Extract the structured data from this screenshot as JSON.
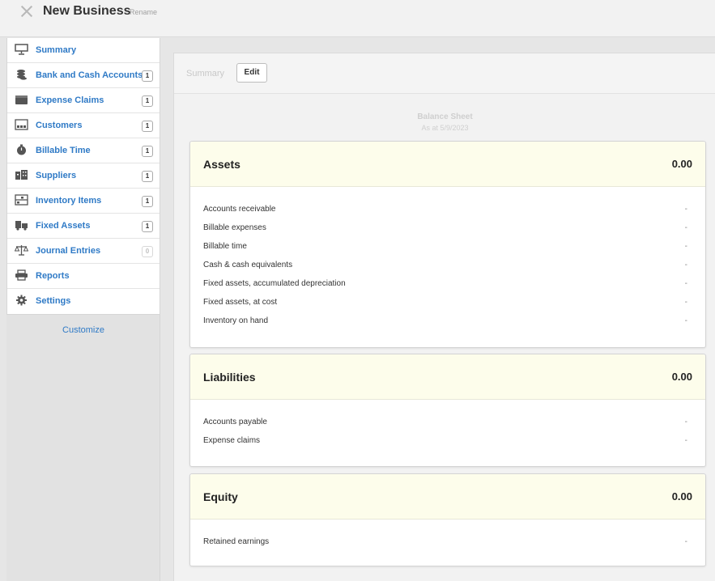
{
  "header": {
    "title": "New Business",
    "rename": "Rename"
  },
  "sidebar": {
    "items": [
      {
        "label": "Summary",
        "icon": "presentation-icon",
        "badge": ""
      },
      {
        "label": "Bank and Cash Accounts",
        "icon": "coins-icon",
        "badge": "1"
      },
      {
        "label": "Expense Claims",
        "icon": "wallet-icon",
        "badge": "1"
      },
      {
        "label": "Customers",
        "icon": "customers-icon",
        "badge": "1"
      },
      {
        "label": "Billable Time",
        "icon": "stopwatch-icon",
        "badge": "1"
      },
      {
        "label": "Suppliers",
        "icon": "buildings-icon",
        "badge": "1"
      },
      {
        "label": "Inventory Items",
        "icon": "inventory-icon",
        "badge": "1"
      },
      {
        "label": "Fixed Assets",
        "icon": "truck-icon",
        "badge": "1"
      },
      {
        "label": "Journal Entries",
        "icon": "scales-icon",
        "badge": "0"
      },
      {
        "label": "Reports",
        "icon": "printer-icon",
        "badge": ""
      },
      {
        "label": "Settings",
        "icon": "gear-icon",
        "badge": ""
      }
    ],
    "customize": "Customize"
  },
  "main": {
    "breadcrumb": "Summary",
    "edit_label": "Edit",
    "report_title": "Balance Sheet",
    "report_date": "As at 5/9/2023",
    "sections": [
      {
        "name": "Assets",
        "total": "0.00",
        "rows": [
          {
            "label": "Accounts receivable",
            "value": "-"
          },
          {
            "label": "Billable expenses",
            "value": "-"
          },
          {
            "label": "Billable time",
            "value": "-"
          },
          {
            "label": "Cash & cash equivalents",
            "value": "-"
          },
          {
            "label": "Fixed assets, accumulated depreciation",
            "value": "-"
          },
          {
            "label": "Fixed assets, at cost",
            "value": "-"
          },
          {
            "label": "Inventory on hand",
            "value": "-"
          }
        ]
      },
      {
        "name": "Liabilities",
        "total": "0.00",
        "rows": [
          {
            "label": "Accounts payable",
            "value": "-"
          },
          {
            "label": "Expense claims",
            "value": "-"
          }
        ]
      },
      {
        "name": "Equity",
        "total": "0.00",
        "rows": [
          {
            "label": "Retained earnings",
            "value": "-"
          }
        ]
      }
    ]
  },
  "colors": {
    "link": "#2f7ac6",
    "section_header_bg": "#fdfdeb",
    "icon": "#555555"
  }
}
